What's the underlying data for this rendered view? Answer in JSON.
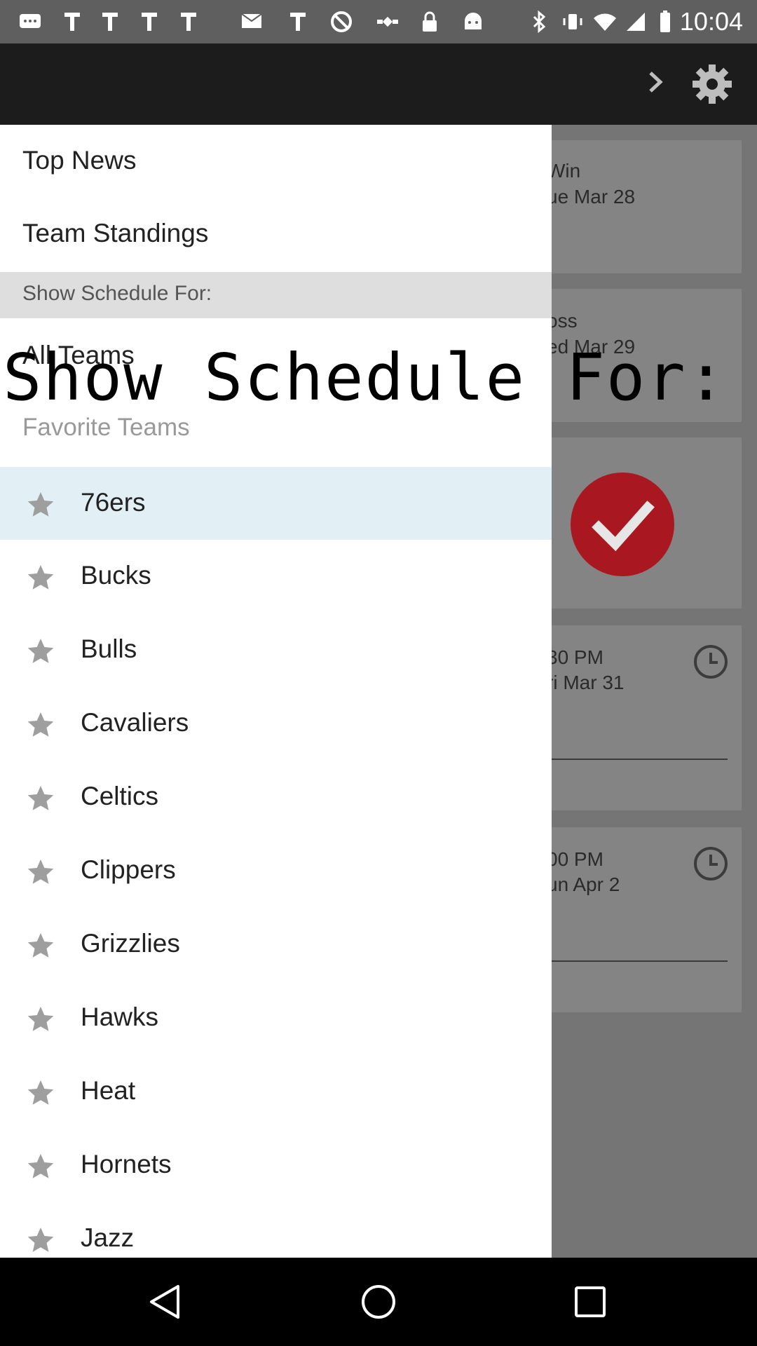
{
  "status_bar": {
    "time": "10:04",
    "icons": [
      "chat-icon",
      "fakegps-icon",
      "fakegps-icon",
      "message-icon",
      "fakegps-icon",
      "block-icon",
      "satellite-icon",
      "lock-icon",
      "android-icon",
      "bluetooth-icon",
      "vibrate-icon",
      "wifi-icon",
      "signal-icon",
      "battery-icon"
    ]
  },
  "background": {
    "cards": [
      {
        "line1": "Win",
        "line2": "ue Mar 28"
      },
      {
        "line1": "oss",
        "line2": "ed Mar 29"
      },
      {
        "line1": "30 PM",
        "line2": "ri Mar 31"
      },
      {
        "line1": "00 PM",
        "line2": "un Apr 2"
      }
    ]
  },
  "drawer": {
    "menu": [
      "Top News",
      "Team Standings"
    ],
    "section_header": "Show Schedule For:",
    "all_teams": "All Teams",
    "favorite_teams": "Favorite Teams",
    "teams": [
      "76ers",
      "Bucks",
      "Bulls",
      "Cavaliers",
      "Celtics",
      "Clippers",
      "Grizzlies",
      "Hawks",
      "Heat",
      "Hornets",
      "Jazz"
    ],
    "selected_team": "76ers"
  },
  "overlay_caption": "Show Schedule For:",
  "colors": {
    "app_bar": "#1c1c1c",
    "drawer_bg": "#ffffff",
    "section_bg": "#dedede",
    "selected_bg": "#e2f0f6",
    "accent_red": "#a91820"
  }
}
